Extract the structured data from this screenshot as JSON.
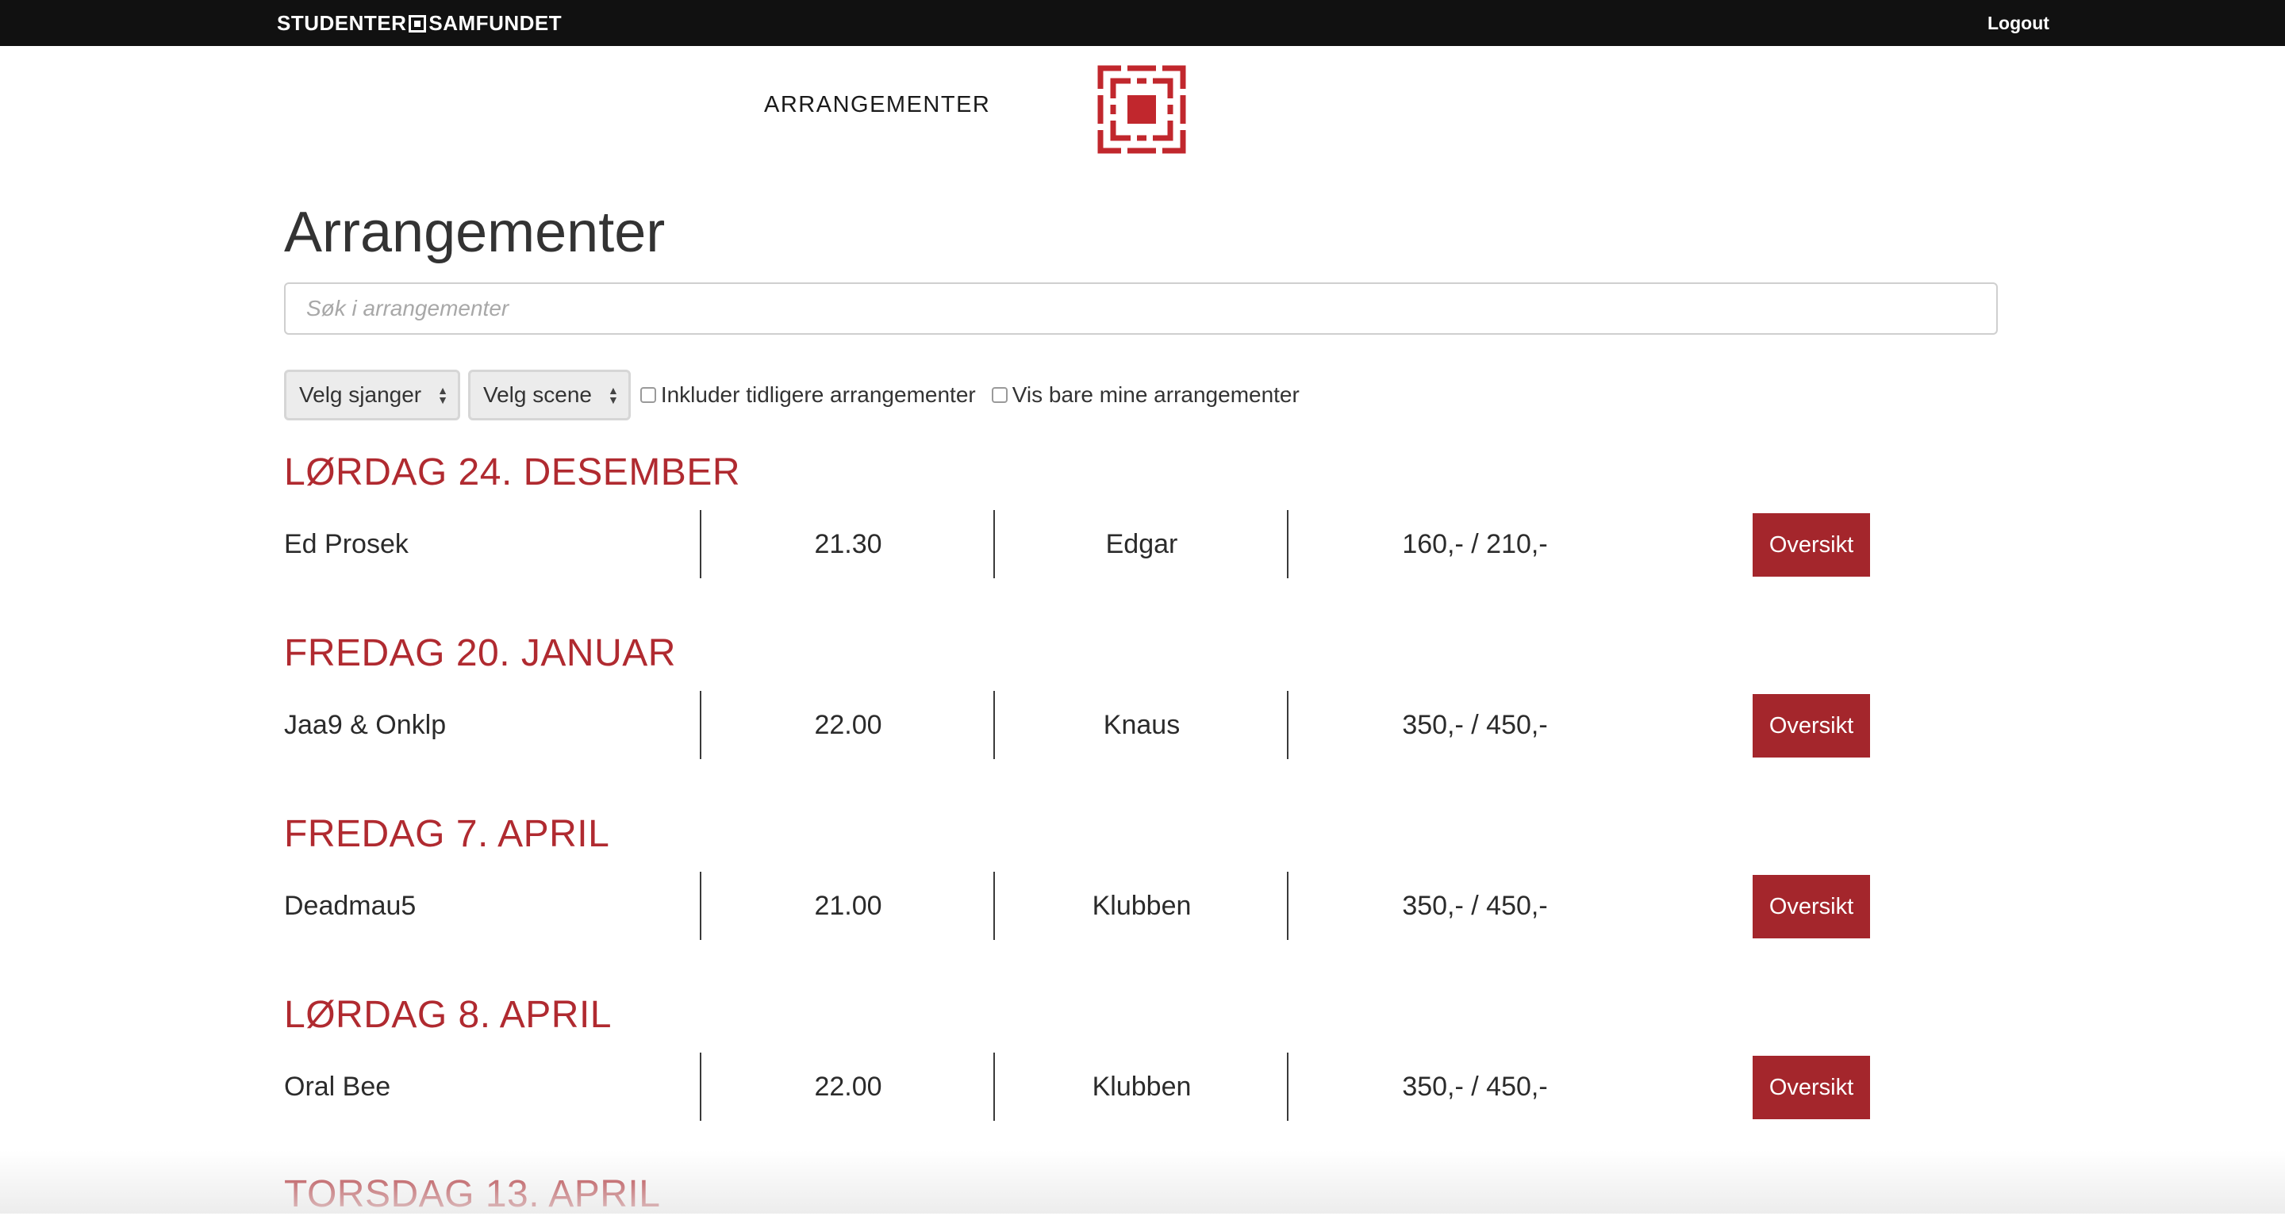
{
  "topbar": {
    "brand_left": "STUDENTER",
    "brand_right": "SAMFUNDET",
    "logout_label": "Logout"
  },
  "header": {
    "nav_title": "ARRANGEMENTER"
  },
  "main": {
    "title": "Arrangementer",
    "search_placeholder": "Søk i arrangementer",
    "filters": {
      "genre_select": "Velg sjanger",
      "scene_select": "Velg scene",
      "include_past_label": "Inkluder tidligere arrangementer",
      "only_mine_label": "Vis bare mine arrangementer"
    },
    "days": [
      {
        "date": "LØRDAG 24. DESEMBER",
        "name": "Ed Prosek",
        "time": "21.30",
        "venue": "Edgar",
        "price": "160,- / 210,-",
        "button": "Oversikt"
      },
      {
        "date": "FREDAG 20. JANUAR",
        "name": "Jaa9 & Onklp",
        "time": "22.00",
        "venue": "Knaus",
        "price": "350,- / 450,-",
        "button": "Oversikt"
      },
      {
        "date": "FREDAG 7. APRIL",
        "name": "Deadmau5",
        "time": "21.00",
        "venue": "Klubben",
        "price": "350,- / 450,-",
        "button": "Oversikt"
      },
      {
        "date": "LØRDAG 8. APRIL",
        "name": "Oral Bee",
        "time": "22.00",
        "venue": "Klubben",
        "price": "350,- / 450,-",
        "button": "Oversikt"
      },
      {
        "date": "TORSDAG 13. APRIL"
      }
    ]
  },
  "colors": {
    "accent": "#b02a30",
    "button": "#a4262c",
    "topbar": "#111111"
  }
}
